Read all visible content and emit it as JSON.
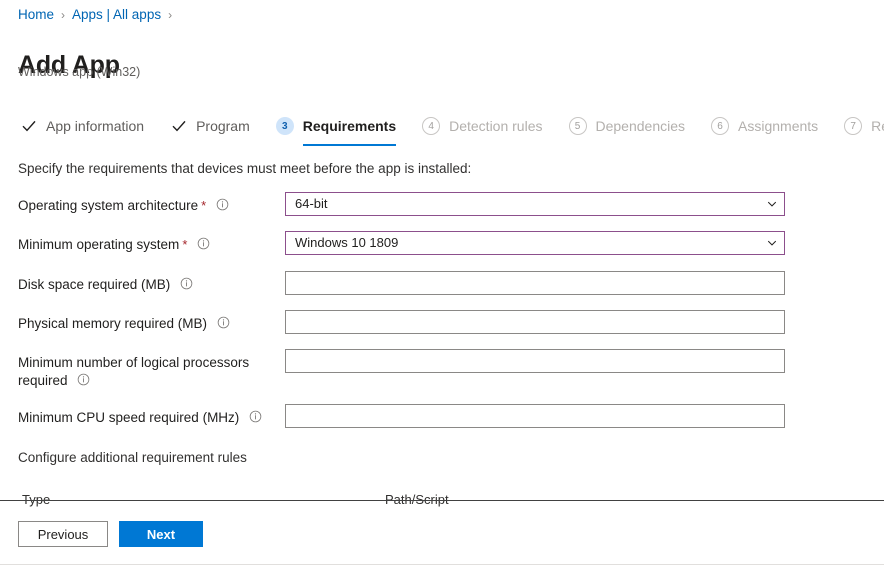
{
  "breadcrumb": {
    "items": [
      {
        "label": "Home",
        "icon": ""
      },
      {
        "label": "Apps | All apps",
        "icon": ""
      }
    ],
    "separator": "›"
  },
  "header": {
    "title": "Add App",
    "subtitle": "Windows app (Win32)"
  },
  "wizard": {
    "steps": [
      {
        "num": "",
        "marker": "check",
        "label": "App information",
        "state": "completed"
      },
      {
        "num": "",
        "marker": "check",
        "label": "Program",
        "state": "completed"
      },
      {
        "num": "3",
        "marker": "num",
        "label": "Requirements",
        "state": "active"
      },
      {
        "num": "4",
        "marker": "num",
        "label": "Detection rules",
        "state": "upcoming"
      },
      {
        "num": "5",
        "marker": "num",
        "label": "Dependencies",
        "state": "upcoming"
      },
      {
        "num": "6",
        "marker": "num",
        "label": "Assignments",
        "state": "upcoming"
      },
      {
        "num": "7",
        "marker": "num",
        "label": "Re",
        "state": "upcoming"
      }
    ]
  },
  "main": {
    "instruction": "Specify the requirements that devices must meet before the app is installed:",
    "fields": [
      {
        "label": "Operating system architecture",
        "required": true,
        "info": "info-icon",
        "control": "select",
        "value": "64-bit",
        "placeholder": ""
      },
      {
        "label": "Minimum operating system",
        "required": true,
        "info": "info-icon",
        "control": "select",
        "value": "Windows 10 1809",
        "placeholder": ""
      },
      {
        "label": "Disk space required (MB)",
        "required": false,
        "info": "info-icon",
        "control": "text",
        "value": "",
        "placeholder": ""
      },
      {
        "label": "Physical memory required (MB)",
        "required": false,
        "info": "info-icon",
        "control": "text",
        "value": "",
        "placeholder": ""
      },
      {
        "label": "Minimum number of logical processors required",
        "required": false,
        "info": "info-icon",
        "control": "text",
        "value": "",
        "placeholder": ""
      },
      {
        "label": "Minimum CPU speed required (MHz)",
        "required": false,
        "info": "info-icon",
        "control": "text",
        "value": "",
        "placeholder": ""
      }
    ],
    "additional_rules_label": "Configure additional requirement rules",
    "rules_table": {
      "columns": [
        "Type",
        "Path/Script"
      ],
      "rows": []
    }
  },
  "footer": {
    "previous_label": "Previous",
    "next_label": "Next"
  },
  "colors": {
    "accent": "#0078d4",
    "link": "#0065b3",
    "required_star": "#a4262c",
    "select_border": "#8c4f8c",
    "input_border": "#8a8886",
    "active_step_bg": "#cfe4fa"
  }
}
